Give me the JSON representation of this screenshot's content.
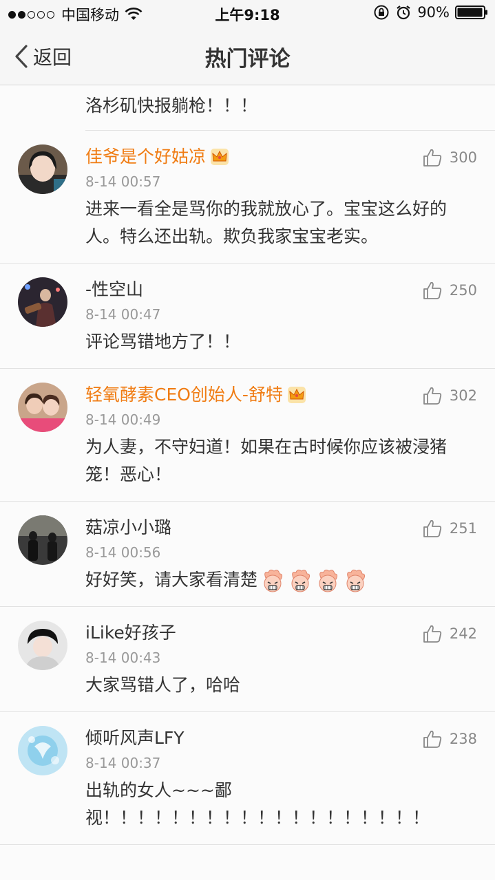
{
  "status_bar": {
    "carrier": "中国移动",
    "time": "上午9:18",
    "battery": "90%"
  },
  "nav": {
    "back_label": "返回",
    "title": "热门评论"
  },
  "partial_comment": {
    "text": "洛杉矶快报躺枪！！！"
  },
  "comments": [
    {
      "name": "佳爷是个好姑凉",
      "time": "8-14 00:57",
      "likes": "300",
      "text": "进来一看全是骂你的我就放心了。宝宝这么好的人。特么还出轨。欺负我家宝宝老实。"
    },
    {
      "name": "-性空山",
      "time": "8-14 00:47",
      "likes": "250",
      "text": "评论骂错地方了！！"
    },
    {
      "name": "轻氧酵素CEO创始人-舒特",
      "time": "8-14 00:49",
      "likes": "302",
      "text": "为人妻，不守妇道！如果在古时候你应该被浸猪笼！恶心！"
    },
    {
      "name": "菇凉小小璐",
      "time": "8-14 00:56",
      "likes": "251",
      "text": "好好笑，请大家看清楚"
    },
    {
      "name": "iLike好孩子",
      "time": "8-14 00:43",
      "likes": "242",
      "text": "大家骂错人了，哈哈"
    },
    {
      "name": "倾听风声LFY",
      "time": "8-14 00:37",
      "likes": "238",
      "text": "出轨的女人~~~鄙视！！！！！！！！！！！！！！！！！！！"
    }
  ],
  "icons": {
    "like": "thumbs-up-icon",
    "crown": "crown-icon",
    "emoji": "angry-face-emoji-icon"
  },
  "colors": {
    "vip_name": "#f07c13",
    "meta": "#999999"
  }
}
